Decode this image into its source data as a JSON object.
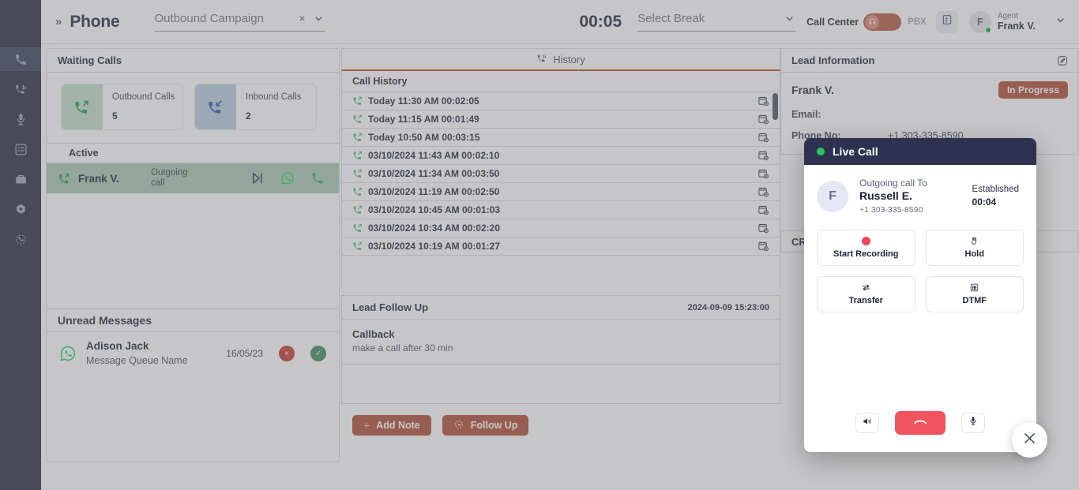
{
  "rail": {
    "items": [
      {
        "icon": "phone-icon",
        "name": "phone",
        "active": true
      },
      {
        "icon": "call-log-icon",
        "name": "call-log",
        "active": false
      },
      {
        "icon": "microphone-icon",
        "name": "microphone",
        "active": false
      },
      {
        "icon": "tasks-icon",
        "name": "tasks",
        "active": false
      },
      {
        "icon": "briefcase-icon",
        "name": "briefcase",
        "active": false
      },
      {
        "icon": "settings-gear-icon",
        "name": "settings",
        "active": false
      },
      {
        "icon": "call-history-clock-icon",
        "name": "call-history",
        "active": false
      }
    ]
  },
  "topbar": {
    "breadcrumb_chevron": "»",
    "title": "Phone",
    "campaign": {
      "value": "",
      "placeholder": "Outbound Campaign",
      "clear": "×"
    },
    "timer": "00:05",
    "break": {
      "value": "",
      "placeholder": "Select Break"
    },
    "call_center_label": "Call Center",
    "pbx_label": "PBX",
    "toggle_on": true,
    "toggle_color": "#b45a42",
    "agent": {
      "initial": "F",
      "role": "Agent",
      "name": "Frank V.",
      "presence_color": "#16a34a"
    }
  },
  "waiting_calls": {
    "title": "Waiting Calls",
    "cards": [
      {
        "label": "Outbound Calls",
        "count": "5",
        "icon": "outgoing-call-icon",
        "color": "#c3ddc9"
      },
      {
        "label": "Inbound Calls",
        "count": "2",
        "icon": "incoming-call-icon",
        "color": "#b9cbdf"
      }
    ],
    "active_title": "Active",
    "active_row": {
      "name": "Frank V.",
      "type": "Outgoing call",
      "actions": [
        "play-next-icon",
        "whatsapp-icon",
        "phone-icon"
      ]
    }
  },
  "unread_messages": {
    "title": "Unread Messages",
    "rows": [
      {
        "channel_icon": "whatsapp-icon",
        "name": "Adison Jack",
        "queue": "Message Queue Name",
        "date": "16/05/23",
        "reject": "×",
        "accept": "✓"
      }
    ]
  },
  "history": {
    "tab_label": "History",
    "tab_icon": "phone-history-icon",
    "list_title": "Call History",
    "rows": [
      {
        "text": "Today 11:30 AM 00:02:05"
      },
      {
        "text": "Today 11:15 AM 00:01:49"
      },
      {
        "text": "Today 10:50 AM 00:03:15"
      },
      {
        "text": "03/10/2024 11:43 AM 00:02:10"
      },
      {
        "text": "03/10/2024 11:34 AM 00:03:50"
      },
      {
        "text": "03/10/2024 11:19 AM 00:02:50"
      },
      {
        "text": "03/10/2024 10:45 AM 00:01:03"
      },
      {
        "text": "03/10/2024 10:34 AM 00:02:20"
      },
      {
        "text": "03/10/2024 10:19 AM 00:01:27"
      }
    ]
  },
  "lead_follow_up": {
    "title": "Lead Follow Up",
    "date": "2024-09-09  15:23:00",
    "items": [
      {
        "title": "Callback",
        "subtitle": "make a call after 30 min"
      }
    ],
    "buttons": [
      {
        "label": "Add Note",
        "icon": "plus-icon"
      },
      {
        "label": "Follow Up",
        "icon": "clock-follow-up-icon"
      }
    ]
  },
  "lead_information": {
    "title": "Lead Information",
    "edit_icon": "edit-pencil-icon",
    "name": "Frank V.",
    "status": "In Progress",
    "status_color": "#b04a33",
    "fields": [
      {
        "key": "Email:",
        "value": ""
      },
      {
        "key": "Phone No:",
        "value": "+1 303-335-8590"
      }
    ],
    "crm_title": "CRM"
  },
  "live_call": {
    "title": "Live Call",
    "status_dot_color": "#22c55e",
    "avatar_initial": "F",
    "direction": "Outgoing call To",
    "contact": "Russell E.",
    "number": "+1 303-335-8590",
    "state_label": "Established",
    "duration": "00:04",
    "actions": [
      {
        "label": "Start Recording",
        "icon": "record-dot-icon"
      },
      {
        "label": "Hold",
        "icon": "hand-hold-icon"
      },
      {
        "label": "Transfer",
        "icon": "transfer-arrows-icon"
      },
      {
        "label": "DTMF",
        "icon": "dialpad-icon"
      }
    ],
    "footer": [
      {
        "icon": "speaker-icon",
        "name": "speaker"
      },
      {
        "icon": "hangup-icon",
        "name": "hangup",
        "color": "#f0545f"
      },
      {
        "icon": "microphone-icon",
        "name": "mute"
      }
    ]
  },
  "close_fab": {
    "icon": "close-icon"
  }
}
